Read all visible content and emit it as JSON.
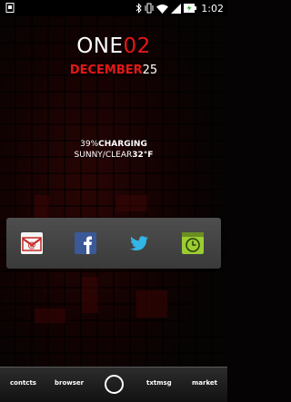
{
  "status_bar": {
    "time": "1:02",
    "icons": [
      "notification-icon",
      "bluetooth-icon",
      "vibrate-icon",
      "wifi-icon",
      "signal-icon",
      "battery-charging-icon"
    ]
  },
  "clock": {
    "hour": "ONE",
    "minute": "02",
    "month": "DECEMBER",
    "day": "25"
  },
  "battery": {
    "percent": "39%",
    "state": "CHARGING"
  },
  "weather": {
    "condition": "SUNNY/CLEAR",
    "temperature": "32°F"
  },
  "dock": {
    "apps": [
      "email-icon",
      "facebook-icon",
      "twitter-icon",
      "clock-app-icon"
    ]
  },
  "bottom_bar": {
    "contacts": "contcts",
    "browser": "browser",
    "messages": "txtmsg",
    "market": "market"
  },
  "colors": {
    "accent_red": "#e41818",
    "facebook_blue": "#3b5998",
    "twitter_blue": "#33b5e5",
    "clock_green": "#9acd32"
  }
}
